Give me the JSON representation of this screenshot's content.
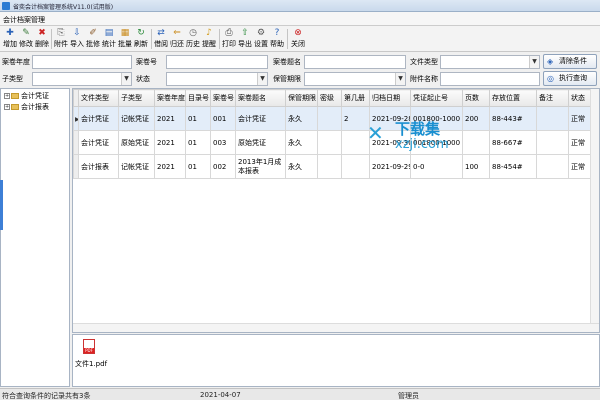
{
  "window": {
    "title": "省奕会计档案管理系统V11.0(试用版)"
  },
  "menu": {
    "label": "会计档案管理"
  },
  "toolbar": [
    {
      "label": "增加",
      "icon": "add-icon"
    },
    {
      "label": "修改",
      "icon": "edit-icon"
    },
    {
      "label": "删除",
      "icon": "delete-icon"
    },
    {
      "label": "附件",
      "icon": "attachment-icon"
    },
    {
      "label": "导入",
      "icon": "import-icon"
    },
    {
      "label": "批修",
      "icon": "batch-edit-icon"
    },
    {
      "label": "统计",
      "icon": "statistics-icon"
    },
    {
      "label": "批量",
      "icon": "batch-icon"
    },
    {
      "label": "刷新",
      "icon": "refresh-icon"
    },
    {
      "label": "借阅",
      "icon": "borrow-icon"
    },
    {
      "label": "归还",
      "icon": "return-icon"
    },
    {
      "label": "历史",
      "icon": "history-icon"
    },
    {
      "label": "提醒",
      "icon": "reminder-icon"
    },
    {
      "label": "打印",
      "icon": "print-icon"
    },
    {
      "label": "导出",
      "icon": "export-icon"
    },
    {
      "label": "设置",
      "icon": "settings-icon"
    },
    {
      "label": "帮助",
      "icon": "help-icon"
    },
    {
      "label": "关闭",
      "icon": "close-icon"
    }
  ],
  "filters": {
    "year_label": "案卷年度",
    "volume_no_label": "案卷号",
    "volume_title_label": "案卷题名",
    "file_type_label": "文件类型",
    "subtype_label": "子类型",
    "status_label": "状态",
    "retention_label": "保管期限",
    "attachment_name_label": "附件名称",
    "clear_button": "清除条件",
    "query_button": "执行查询"
  },
  "tree": {
    "items": [
      {
        "label": "会计凭证"
      },
      {
        "label": "会计报表"
      }
    ]
  },
  "table": {
    "columns": [
      "文件类型",
      "子类型",
      "案卷年度",
      "目录号",
      "案卷号",
      "案卷题名",
      "保管期限",
      "密级",
      "第几册",
      "归档日期",
      "凭证起止号",
      "页数",
      "存放位置",
      "备注",
      "状态"
    ],
    "rows": [
      [
        "会计凭证",
        "记帐凭证",
        "2021",
        "01",
        "001",
        "会计凭证",
        "永久",
        "",
        "2",
        "2021-09-28",
        "001800-1000",
        "200",
        "88-443#",
        "",
        "正常"
      ],
      [
        "会计凭证",
        "原始凭证",
        "2021",
        "01",
        "003",
        "原始凭证",
        "永久",
        "",
        "",
        "2021-09-30",
        "001800-1000",
        "",
        "88-667#",
        "",
        "正常"
      ],
      [
        "会计报表",
        "记帐凭证",
        "2021",
        "01",
        "002",
        "2013年1月成本报表",
        "永久",
        "",
        "",
        "2021-09-29",
        "0-0",
        "100",
        "88-454#",
        "",
        "正常"
      ]
    ]
  },
  "attachment": {
    "filename": "文件1.pdf"
  },
  "status": {
    "count_text": "符合查询条件的记录共有3条",
    "date": "2021-04-07",
    "user": "管理员"
  },
  "watermark": {
    "brand": "下载集",
    "domain": "xzji.com"
  },
  "colors": {
    "accent": "#2a62b8",
    "selected_row": "#e3edf9",
    "watermark": "#2aa0d6"
  }
}
